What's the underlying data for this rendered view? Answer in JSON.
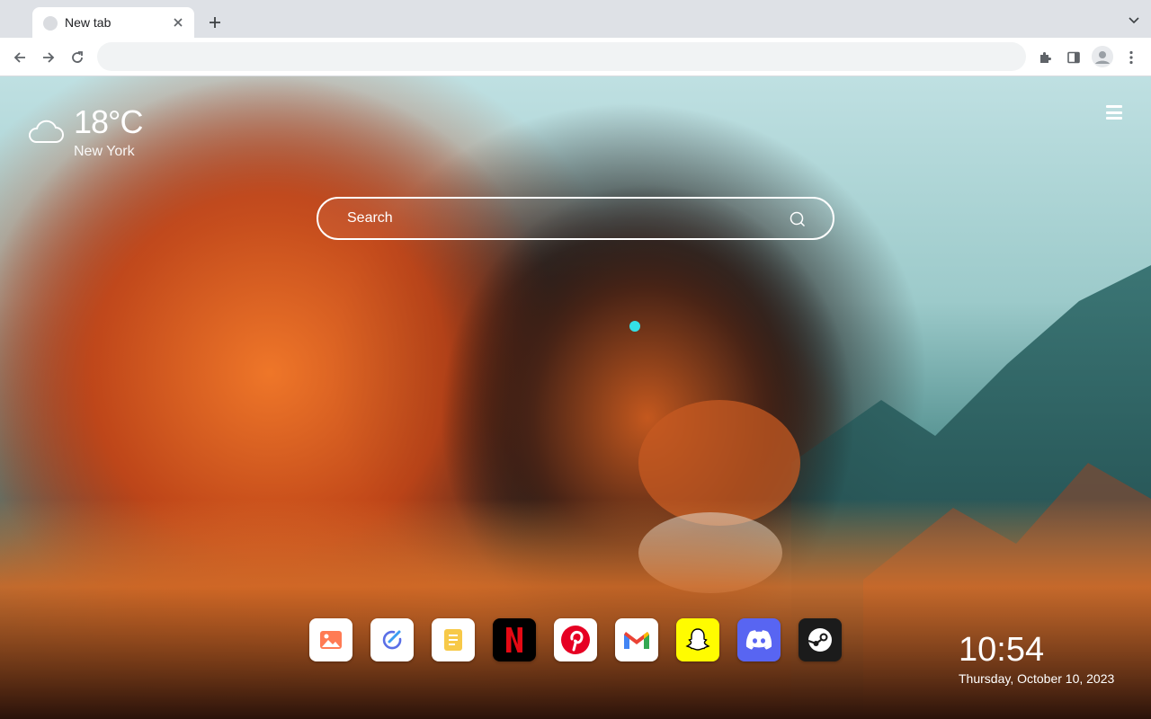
{
  "browser": {
    "tab_title": "New tab",
    "address": ""
  },
  "weather": {
    "temperature": "18°C",
    "city": "New York",
    "icon": "cloud-icon"
  },
  "search": {
    "placeholder": "Search"
  },
  "apps": [
    {
      "name": "photos",
      "icon": "image-icon",
      "bg": "#ffffff"
    },
    {
      "name": "tasks",
      "icon": "check-pen-icon",
      "bg": "#ffffff"
    },
    {
      "name": "notes",
      "icon": "note-icon",
      "bg": "#ffffff"
    },
    {
      "name": "netflix",
      "icon": "netflix-icon",
      "bg": "#000000",
      "accent": "#e50914"
    },
    {
      "name": "pinterest",
      "icon": "pinterest-icon",
      "bg": "#ffffff",
      "accent": "#e60023"
    },
    {
      "name": "gmail",
      "icon": "gmail-icon",
      "bg": "#ffffff"
    },
    {
      "name": "snapchat",
      "icon": "snapchat-icon",
      "bg": "#fffc00"
    },
    {
      "name": "discord",
      "icon": "discord-icon",
      "bg": "#5865f2"
    },
    {
      "name": "steam",
      "icon": "steam-icon",
      "bg": "#1b1b1b"
    }
  ],
  "clock": {
    "time": "10:54",
    "date": "Thursday, October 10, 2023"
  }
}
